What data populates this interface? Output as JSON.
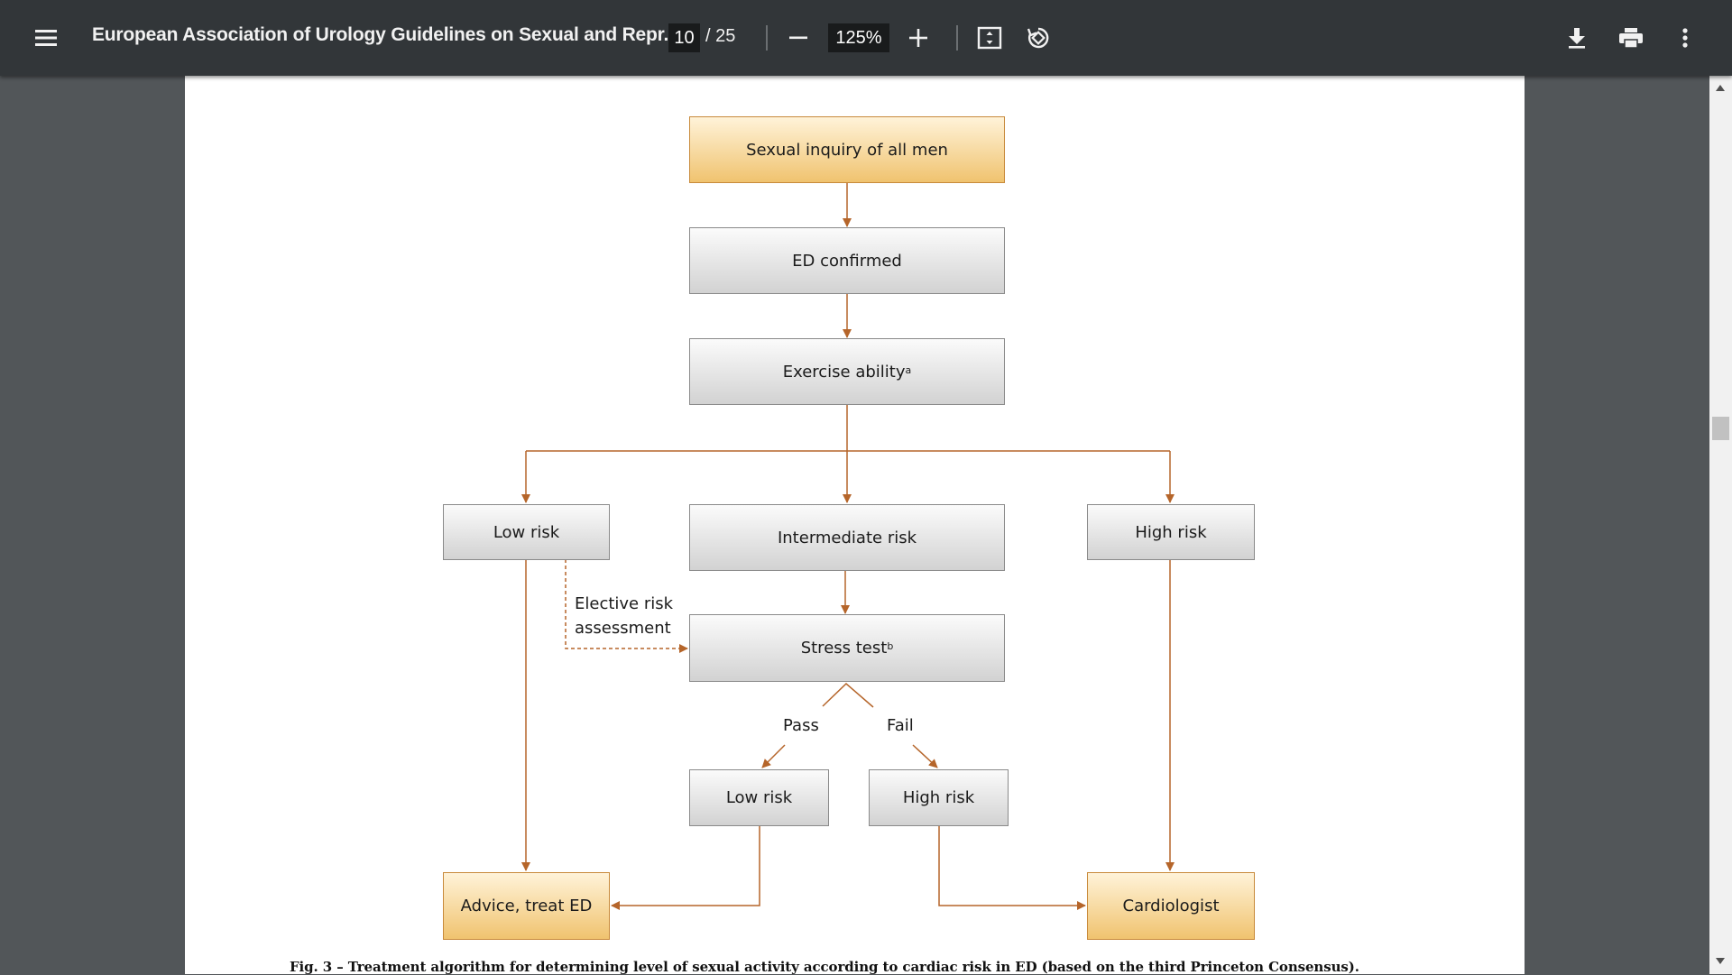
{
  "toolbar": {
    "title": "European Association of Urology Guidelines on Sexual and Repr...",
    "current_page": "10",
    "total_pages": "/ 25",
    "zoom": "125%",
    "icons": [
      "menu-icon",
      "zoom-out-icon",
      "zoom-in-icon",
      "fit-page-icon",
      "rotate-icon",
      "download-icon",
      "print-icon",
      "more-options-icon"
    ]
  },
  "flowchart": {
    "sexual_inquiry": "Sexual inquiry of all men",
    "ed_confirmed": "ED confirmed",
    "exercise_ability": "Exercise ability",
    "exercise_sup": "a",
    "low_risk": "Low risk",
    "intermediate_risk": "Intermediate risk",
    "high_risk": "High risk",
    "elective_line1": "Elective risk",
    "elective_line2": "assessment",
    "stress_test": "Stress test",
    "stress_sup": "b",
    "pass": "Pass",
    "fail": "Fail",
    "stress_low_risk": "Low risk",
    "stress_high_risk": "High risk",
    "advice": "Advice, treat ED",
    "cardiologist": "Cardiologist"
  },
  "caption": "Fig. 3 – Treatment algorithm for determining level of sexual activity according to cardiac risk in ED (based on the third Princeton Consensus).",
  "colors": {
    "toolbar_bg": "#323639",
    "viewer_bg": "#525659",
    "connector": "#b5652a",
    "highlight_box": "#f0c36f"
  }
}
